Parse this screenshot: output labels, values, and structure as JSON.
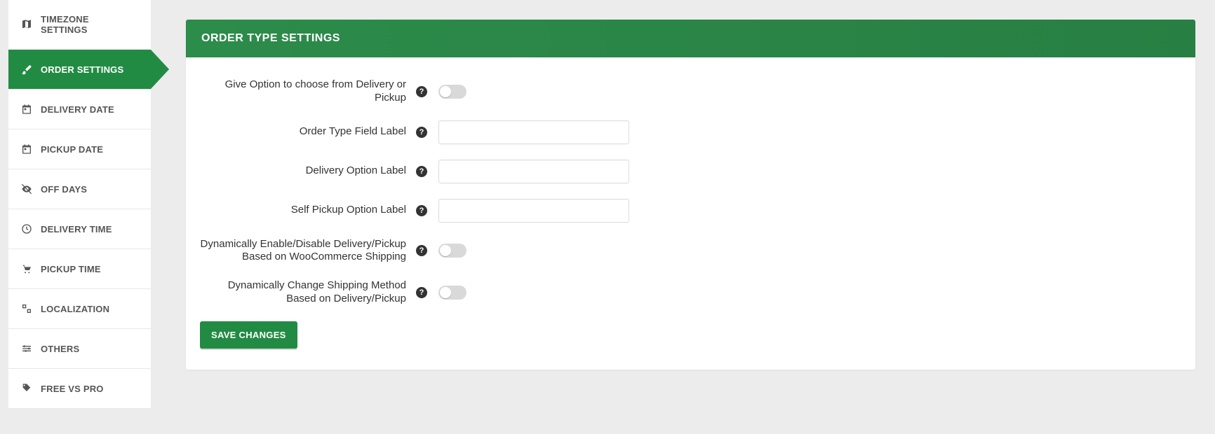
{
  "sidebar": {
    "items": [
      {
        "id": "timezone-settings",
        "label": "TIMEZONE SETTINGS",
        "icon": "map"
      },
      {
        "id": "order-settings",
        "label": "ORDER SETTINGS",
        "icon": "brush",
        "active": true
      },
      {
        "id": "delivery-date",
        "label": "DELIVERY DATE",
        "icon": "calendar"
      },
      {
        "id": "pickup-date",
        "label": "PICKUP DATE",
        "icon": "calendar"
      },
      {
        "id": "off-days",
        "label": "OFF DAYS",
        "icon": "eye-slash"
      },
      {
        "id": "delivery-time",
        "label": "DELIVERY TIME",
        "icon": "clock"
      },
      {
        "id": "pickup-time",
        "label": "PICKUP TIME",
        "icon": "cart"
      },
      {
        "id": "localization",
        "label": "LOCALIZATION",
        "icon": "translate"
      },
      {
        "id": "others",
        "label": "OTHERS",
        "icon": "sliders"
      },
      {
        "id": "free-vs-pro",
        "label": "FREE VS PRO",
        "icon": "tag"
      }
    ]
  },
  "panel": {
    "title": "ORDER TYPE SETTINGS"
  },
  "form": {
    "option_toggle_label": "Give Option to choose from Delivery or Pickup",
    "option_toggle_on": false,
    "field_label_label": "Order Type Field Label",
    "field_label_value": "",
    "delivery_option_label_label": "Delivery Option Label",
    "delivery_option_label_value": "",
    "pickup_option_label_label": "Self Pickup Option Label",
    "pickup_option_label_value": "",
    "dynamic_enable_label": "Dynamically Enable/Disable Delivery/Pickup Based on WooCommerce Shipping",
    "dynamic_enable_on": false,
    "dynamic_shipping_label": "Dynamically Change Shipping Method Based on Delivery/Pickup",
    "dynamic_shipping_on": false,
    "save_label": "SAVE CHANGES"
  }
}
